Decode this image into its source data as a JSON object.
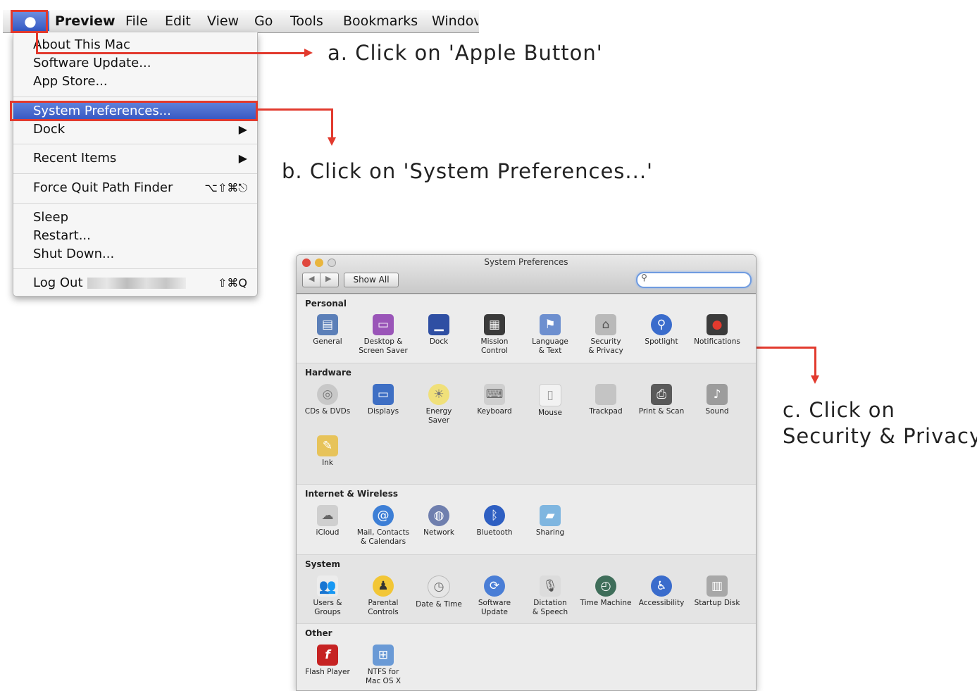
{
  "menubar": {
    "apple_symbol": "",
    "items": [
      "Preview",
      "File",
      "Edit",
      "View",
      "Go",
      "Tools",
      "Bookmarks",
      "Windov"
    ]
  },
  "apple_menu": {
    "about": "About This Mac",
    "software_update": "Software Update...",
    "app_store": "App Store...",
    "system_preferences": "System Preferences...",
    "dock": "Dock",
    "recent_items": "Recent Items",
    "force_quit": "Force Quit Path Finder",
    "force_quit_shortcut": "⌥⇧⌘⎋",
    "sleep": "Sleep",
    "restart": "Restart...",
    "shut_down": "Shut Down...",
    "log_out": "Log Out",
    "log_out_shortcut": "⇧⌘Q",
    "submenu_arrow": "▶"
  },
  "annotations": {
    "a": "a. Click on 'Apple Button'",
    "b": "b. Click on 'System Preferences...'",
    "c_line1": "c. Click on",
    "c_line2": "Security & Privacy"
  },
  "syspref": {
    "title": "System Preferences",
    "show_all": "Show All",
    "nav_back": "◀",
    "nav_fwd": "▶",
    "search_icon": "magnifier-icon",
    "sections": {
      "personal": "Personal",
      "hardware": "Hardware",
      "internet": "Internet & Wireless",
      "system": "System",
      "other": "Other"
    },
    "personal": [
      "General",
      "Desktop &\nScreen Saver",
      "Dock",
      "Mission\nControl",
      "Language\n& Text",
      "Security\n& Privacy",
      "Spotlight",
      "Notifications"
    ],
    "hardware": [
      "CDs & DVDs",
      "Displays",
      "Energy\nSaver",
      "Keyboard",
      "Mouse",
      "Trackpad",
      "Print & Scan",
      "Sound",
      "Ink"
    ],
    "internet": [
      "iCloud",
      "Mail, Contacts\n& Calendars",
      "Network",
      "Bluetooth",
      "Sharing"
    ],
    "system": [
      "Users &\nGroups",
      "Parental\nControls",
      "Date & Time",
      "Software\nUpdate",
      "Dictation\n& Speech",
      "Time Machine",
      "Accessibility",
      "Startup Disk"
    ],
    "other": [
      "Flash Player",
      "NTFS for\nMac OS X"
    ]
  },
  "colors": {
    "annotation_red": "#e23a2e",
    "menu_highlight": "#3656c0"
  }
}
